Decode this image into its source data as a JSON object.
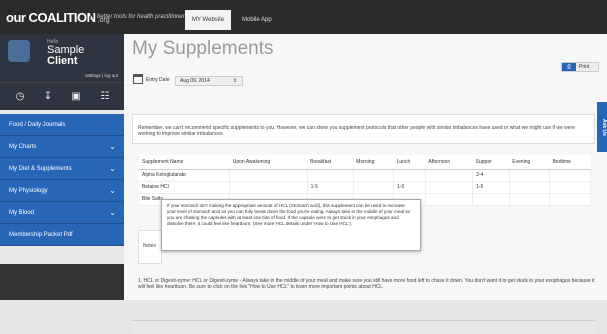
{
  "topbar": {
    "logo_main": "our COALITION",
    "logo_suffix": ".org",
    "tagline": "better tools for health practitioners",
    "tabs": [
      "MY Website",
      "Mobile App"
    ]
  },
  "sidebar": {
    "hello": "Hello",
    "client_first": "Sample",
    "client_last": "Client",
    "settings": "settings | log out",
    "icons": [
      "clock-icon",
      "download-icon",
      "film-icon",
      "book-icon"
    ],
    "nav": [
      {
        "label": "Food / Daily Journals",
        "chevron": false
      },
      {
        "label": "My Charts",
        "chevron": true
      },
      {
        "label": "My Diet & Supplements",
        "chevron": true
      },
      {
        "label": "My Physiology",
        "chevron": true
      },
      {
        "label": "My Blood",
        "chevron": true
      },
      {
        "label": "Membership Packet Pdf",
        "chevron": false
      }
    ]
  },
  "main": {
    "title": "My Supplements",
    "print_label": "Print",
    "ask_us": "Ask Us",
    "entry_date_label": "Entry Date",
    "entry_date_value": "Aug 09, 2014",
    "notice": "Remember, we can't recommend specific supplements to you. However, we can show you supplement protocols that other people with similar imbalances have used or what we might use if we were working to improve similar imbalances.",
    "table": {
      "headers": [
        "Supplement Name",
        "Upon Awakening",
        "Breakfast",
        "Morning",
        "Lunch",
        "Afternoon",
        "Supper",
        "Evening",
        "Bedtime"
      ],
      "rows": [
        [
          "Alpha Ketoglutarate",
          "",
          "",
          "",
          "",
          "",
          "2-4",
          "",
          ""
        ],
        [
          "Betaine HCl",
          "",
          "1-5",
          "",
          "1-5",
          "",
          "1-5",
          "",
          ""
        ],
        [
          "Bile Salts",
          "",
          "",
          "",
          "",
          "",
          "",
          "",
          ""
        ]
      ]
    },
    "tooltip": "If your stomach isn't making the appropriate amount of HCL (Stomach acid), this supplement can be used to increase your level of stomach acid so you can fully break down the food you're eating. Always take in the middle of your meal so you are chasing the capsules with at least one bite of food. If the capsule were to get stuck in your esophagus and dissolve there, it could feel like heartburn. (See more HCL details under 'How to Use HCL').",
    "notes_label": "Notes",
    "hcl_text": "1.  HCL or Digesti-zyme: HCL or Digesti-zyme - Always take in the middle of your meal and make sure you still have more food left to chase it down. You don't want it to get stuck in your esophagus because it will feel like heartburn. Be sure to click on the link \"How to Use HCL\" to learn more important points about HCL."
  },
  "colors": {
    "accent": "#2765b6",
    "dark": "#2b2b2b"
  }
}
